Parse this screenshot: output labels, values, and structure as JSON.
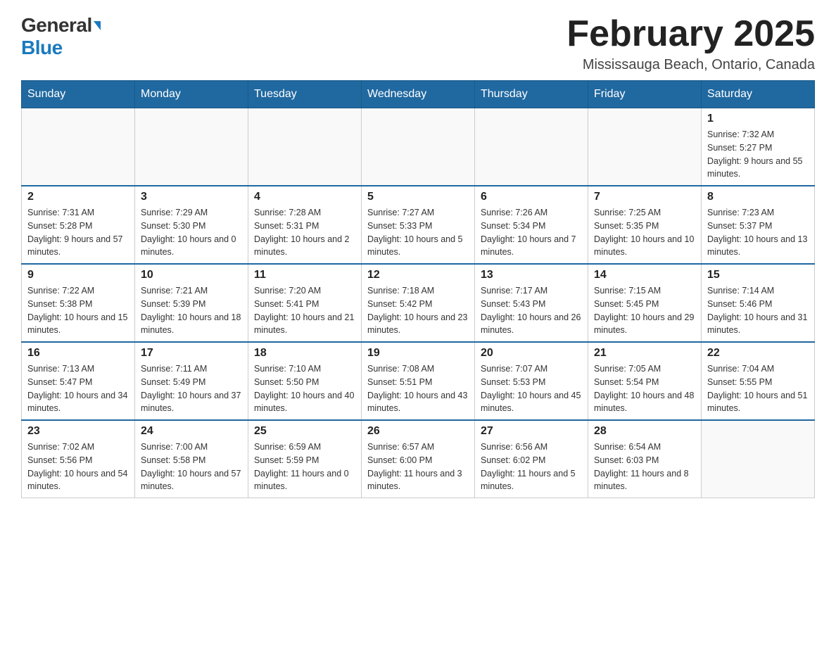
{
  "header": {
    "logo_general": "General",
    "logo_blue": "Blue",
    "month_title": "February 2025",
    "location": "Mississauga Beach, Ontario, Canada"
  },
  "days_of_week": [
    "Sunday",
    "Monday",
    "Tuesday",
    "Wednesday",
    "Thursday",
    "Friday",
    "Saturday"
  ],
  "weeks": [
    [
      {
        "day": "",
        "sunrise": "",
        "sunset": "",
        "daylight": ""
      },
      {
        "day": "",
        "sunrise": "",
        "sunset": "",
        "daylight": ""
      },
      {
        "day": "",
        "sunrise": "",
        "sunset": "",
        "daylight": ""
      },
      {
        "day": "",
        "sunrise": "",
        "sunset": "",
        "daylight": ""
      },
      {
        "day": "",
        "sunrise": "",
        "sunset": "",
        "daylight": ""
      },
      {
        "day": "",
        "sunrise": "",
        "sunset": "",
        "daylight": ""
      },
      {
        "day": "1",
        "sunrise": "Sunrise: 7:32 AM",
        "sunset": "Sunset: 5:27 PM",
        "daylight": "Daylight: 9 hours and 55 minutes."
      }
    ],
    [
      {
        "day": "2",
        "sunrise": "Sunrise: 7:31 AM",
        "sunset": "Sunset: 5:28 PM",
        "daylight": "Daylight: 9 hours and 57 minutes."
      },
      {
        "day": "3",
        "sunrise": "Sunrise: 7:29 AM",
        "sunset": "Sunset: 5:30 PM",
        "daylight": "Daylight: 10 hours and 0 minutes."
      },
      {
        "day": "4",
        "sunrise": "Sunrise: 7:28 AM",
        "sunset": "Sunset: 5:31 PM",
        "daylight": "Daylight: 10 hours and 2 minutes."
      },
      {
        "day": "5",
        "sunrise": "Sunrise: 7:27 AM",
        "sunset": "Sunset: 5:33 PM",
        "daylight": "Daylight: 10 hours and 5 minutes."
      },
      {
        "day": "6",
        "sunrise": "Sunrise: 7:26 AM",
        "sunset": "Sunset: 5:34 PM",
        "daylight": "Daylight: 10 hours and 7 minutes."
      },
      {
        "day": "7",
        "sunrise": "Sunrise: 7:25 AM",
        "sunset": "Sunset: 5:35 PM",
        "daylight": "Daylight: 10 hours and 10 minutes."
      },
      {
        "day": "8",
        "sunrise": "Sunrise: 7:23 AM",
        "sunset": "Sunset: 5:37 PM",
        "daylight": "Daylight: 10 hours and 13 minutes."
      }
    ],
    [
      {
        "day": "9",
        "sunrise": "Sunrise: 7:22 AM",
        "sunset": "Sunset: 5:38 PM",
        "daylight": "Daylight: 10 hours and 15 minutes."
      },
      {
        "day": "10",
        "sunrise": "Sunrise: 7:21 AM",
        "sunset": "Sunset: 5:39 PM",
        "daylight": "Daylight: 10 hours and 18 minutes."
      },
      {
        "day": "11",
        "sunrise": "Sunrise: 7:20 AM",
        "sunset": "Sunset: 5:41 PM",
        "daylight": "Daylight: 10 hours and 21 minutes."
      },
      {
        "day": "12",
        "sunrise": "Sunrise: 7:18 AM",
        "sunset": "Sunset: 5:42 PM",
        "daylight": "Daylight: 10 hours and 23 minutes."
      },
      {
        "day": "13",
        "sunrise": "Sunrise: 7:17 AM",
        "sunset": "Sunset: 5:43 PM",
        "daylight": "Daylight: 10 hours and 26 minutes."
      },
      {
        "day": "14",
        "sunrise": "Sunrise: 7:15 AM",
        "sunset": "Sunset: 5:45 PM",
        "daylight": "Daylight: 10 hours and 29 minutes."
      },
      {
        "day": "15",
        "sunrise": "Sunrise: 7:14 AM",
        "sunset": "Sunset: 5:46 PM",
        "daylight": "Daylight: 10 hours and 31 minutes."
      }
    ],
    [
      {
        "day": "16",
        "sunrise": "Sunrise: 7:13 AM",
        "sunset": "Sunset: 5:47 PM",
        "daylight": "Daylight: 10 hours and 34 minutes."
      },
      {
        "day": "17",
        "sunrise": "Sunrise: 7:11 AM",
        "sunset": "Sunset: 5:49 PM",
        "daylight": "Daylight: 10 hours and 37 minutes."
      },
      {
        "day": "18",
        "sunrise": "Sunrise: 7:10 AM",
        "sunset": "Sunset: 5:50 PM",
        "daylight": "Daylight: 10 hours and 40 minutes."
      },
      {
        "day": "19",
        "sunrise": "Sunrise: 7:08 AM",
        "sunset": "Sunset: 5:51 PM",
        "daylight": "Daylight: 10 hours and 43 minutes."
      },
      {
        "day": "20",
        "sunrise": "Sunrise: 7:07 AM",
        "sunset": "Sunset: 5:53 PM",
        "daylight": "Daylight: 10 hours and 45 minutes."
      },
      {
        "day": "21",
        "sunrise": "Sunrise: 7:05 AM",
        "sunset": "Sunset: 5:54 PM",
        "daylight": "Daylight: 10 hours and 48 minutes."
      },
      {
        "day": "22",
        "sunrise": "Sunrise: 7:04 AM",
        "sunset": "Sunset: 5:55 PM",
        "daylight": "Daylight: 10 hours and 51 minutes."
      }
    ],
    [
      {
        "day": "23",
        "sunrise": "Sunrise: 7:02 AM",
        "sunset": "Sunset: 5:56 PM",
        "daylight": "Daylight: 10 hours and 54 minutes."
      },
      {
        "day": "24",
        "sunrise": "Sunrise: 7:00 AM",
        "sunset": "Sunset: 5:58 PM",
        "daylight": "Daylight: 10 hours and 57 minutes."
      },
      {
        "day": "25",
        "sunrise": "Sunrise: 6:59 AM",
        "sunset": "Sunset: 5:59 PM",
        "daylight": "Daylight: 11 hours and 0 minutes."
      },
      {
        "day": "26",
        "sunrise": "Sunrise: 6:57 AM",
        "sunset": "Sunset: 6:00 PM",
        "daylight": "Daylight: 11 hours and 3 minutes."
      },
      {
        "day": "27",
        "sunrise": "Sunrise: 6:56 AM",
        "sunset": "Sunset: 6:02 PM",
        "daylight": "Daylight: 11 hours and 5 minutes."
      },
      {
        "day": "28",
        "sunrise": "Sunrise: 6:54 AM",
        "sunset": "Sunset: 6:03 PM",
        "daylight": "Daylight: 11 hours and 8 minutes."
      },
      {
        "day": "",
        "sunrise": "",
        "sunset": "",
        "daylight": ""
      }
    ]
  ]
}
